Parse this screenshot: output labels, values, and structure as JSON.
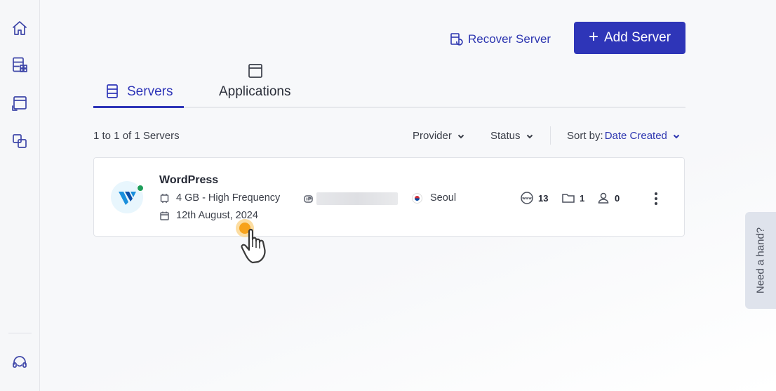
{
  "sidebar": {
    "items": [
      {
        "icon": "home-icon"
      },
      {
        "icon": "server-apps-icon"
      },
      {
        "icon": "window-icon"
      },
      {
        "icon": "layers-icon"
      }
    ],
    "support_icon": "headset-icon"
  },
  "header": {
    "recover_label": "Recover Server",
    "add_label": "Add Server",
    "accent": "#2e35b8"
  },
  "tabs": [
    {
      "label": "Servers",
      "active": true
    },
    {
      "label": "Applications",
      "active": false
    }
  ],
  "list": {
    "count_text": "1 to 1 of 1 Servers",
    "filters": {
      "provider": "Provider",
      "status": "Status",
      "sort_label": "Sort by:",
      "sort_value": "Date Created"
    }
  },
  "servers": [
    {
      "name": "WordPress",
      "status_color": "#1e9e5a",
      "spec": "4 GB - High Frequency",
      "created": "12th August, 2024",
      "location": "Seoul",
      "websites": "13",
      "folders": "1",
      "users": "0"
    }
  ],
  "help": {
    "label": "Need a hand?"
  }
}
